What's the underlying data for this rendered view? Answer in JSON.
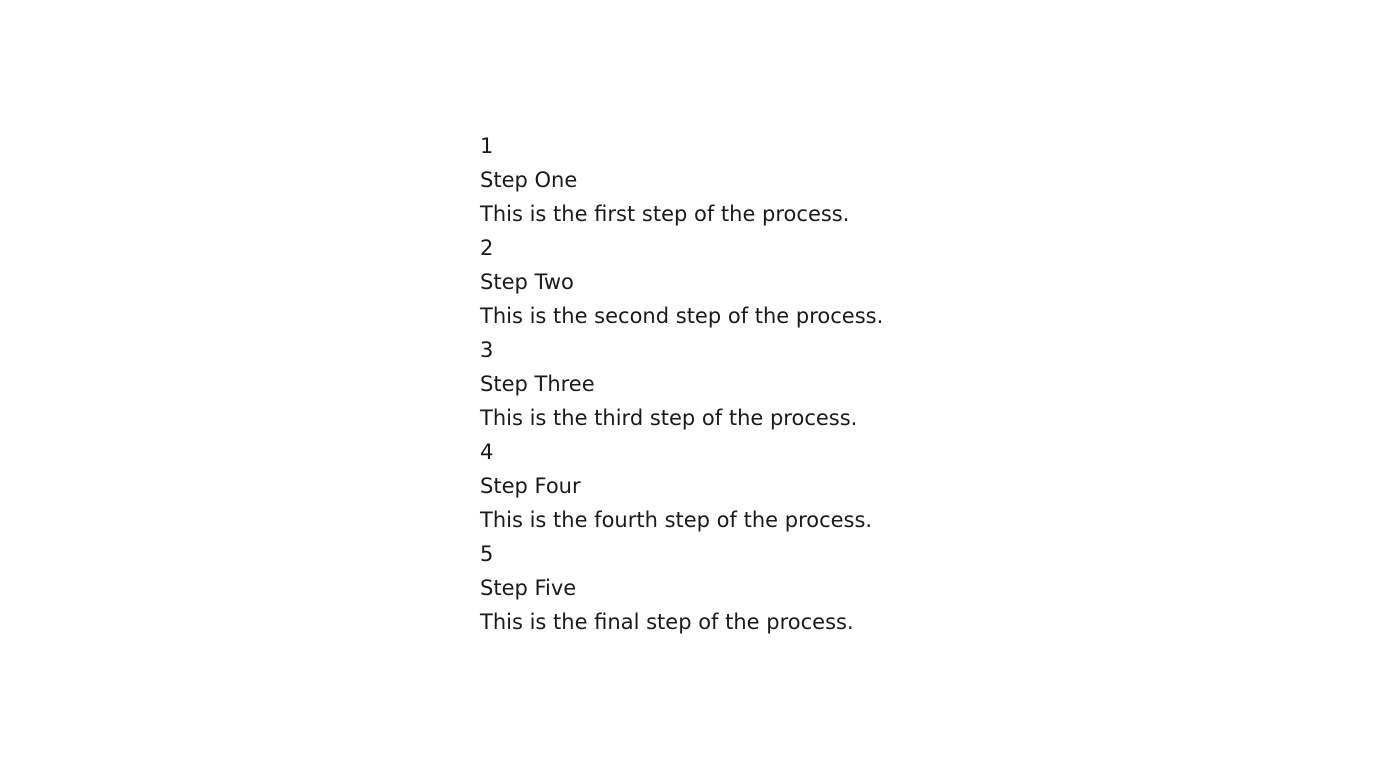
{
  "steps": [
    {
      "number": "1",
      "title": "Step One",
      "description": "This is the first step of the process."
    },
    {
      "number": "2",
      "title": "Step Two",
      "description": "This is the second step of the process."
    },
    {
      "number": "3",
      "title": "Step Three",
      "description": "This is the third step of the process."
    },
    {
      "number": "4",
      "title": "Step Four",
      "description": "This is the fourth step of the process."
    },
    {
      "number": "5",
      "title": "Step Five",
      "description": "This is the final step of the process."
    }
  ]
}
